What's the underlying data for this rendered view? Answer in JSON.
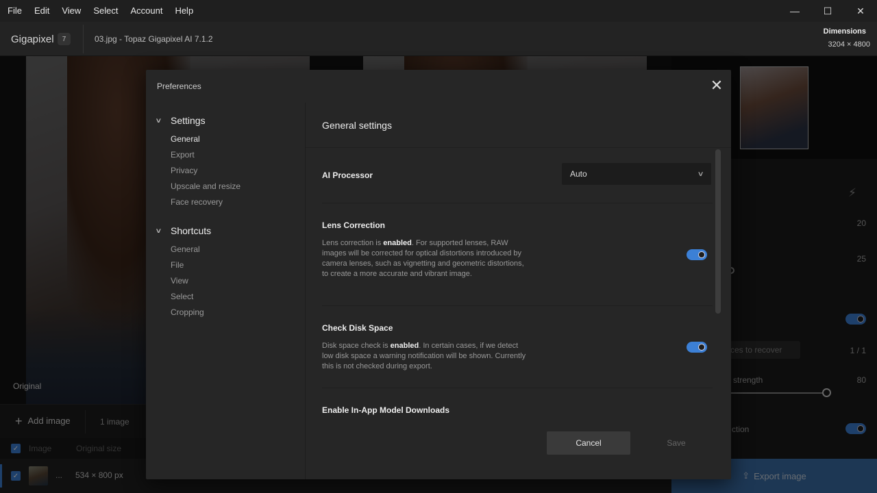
{
  "menubar": {
    "items": [
      "File",
      "Edit",
      "View",
      "Select",
      "Account",
      "Help"
    ]
  },
  "window_controls": {
    "minimize": "—",
    "maximize": "☐",
    "close": "✕"
  },
  "header": {
    "app_name": "Gigapixel",
    "badge": "7",
    "document_title": "03.jpg - Topaz Gigapixel AI 7.1.2",
    "dimensions_label": "Dimensions",
    "dimensions_value": "3204 × 4800"
  },
  "canvas": {
    "original_label": "Original"
  },
  "bottombar": {
    "add_image_label": "Add image",
    "image_count": "1 image"
  },
  "file_list": {
    "headers": [
      "Image",
      "Original size"
    ],
    "rows": [
      {
        "name": "...",
        "size": "534 × 800 px"
      }
    ]
  },
  "right_panel": {
    "value_a": "20",
    "value_b": "25",
    "faces_button": "ces to recover",
    "faces_ratio": "1 / 1",
    "strength_label": "strength",
    "strength_value": "80",
    "correction_label": "ction",
    "export_button": "Export image"
  },
  "dialog": {
    "title": "Preferences",
    "nav": {
      "settings_label": "Settings",
      "settings_items": [
        "General",
        "Export",
        "Privacy",
        "Upscale and resize",
        "Face recovery"
      ],
      "shortcuts_label": "Shortcuts",
      "shortcuts_items": [
        "General",
        "File",
        "View",
        "Select",
        "Cropping"
      ]
    },
    "section_title": "General settings",
    "ai_processor": {
      "label": "AI Processor",
      "value": "Auto"
    },
    "lens_correction": {
      "label": "Lens Correction",
      "desc_prefix": "Lens correction is ",
      "desc_state": "enabled",
      "desc_rest": ". For supported lenses, RAW images will be corrected for optical distortions introduced by camera lenses, such as vignetting and geometric distortions, to create a more accurate and vibrant image.",
      "enabled": true
    },
    "check_disk": {
      "label": "Check Disk Space",
      "desc_prefix": "Disk space check is ",
      "desc_state": "enabled",
      "desc_rest": ". In certain cases, if we detect low disk space a warning notification will be shown. Currently this is not checked during export.",
      "enabled": true
    },
    "model_downloads": {
      "label": "Enable In-App Model Downloads"
    },
    "cancel_label": "Cancel",
    "save_label": "Save"
  },
  "colors": {
    "accent": "#3c80d6",
    "dialog_bg": "#262626"
  }
}
